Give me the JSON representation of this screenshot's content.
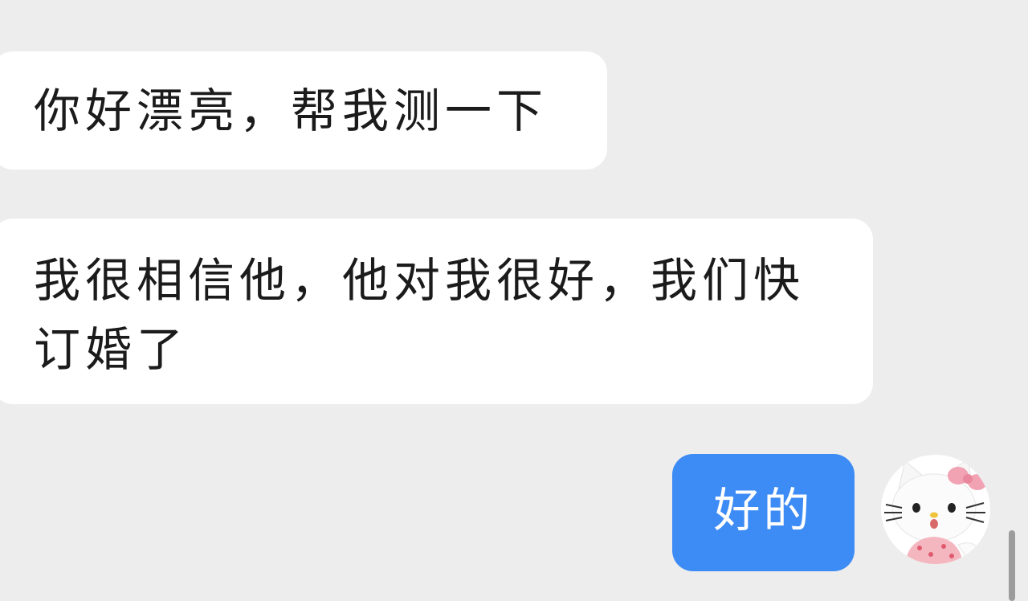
{
  "messages": [
    {
      "direction": "incoming",
      "text": "你好漂亮，帮我测一下"
    },
    {
      "direction": "incoming",
      "text": "我很相信他，他对我很好，我们快订婚了"
    },
    {
      "direction": "outgoing",
      "text": "好的"
    }
  ],
  "avatar": {
    "icon": "hello-kitty-avatar-icon"
  },
  "colors": {
    "background": "#ededed",
    "incoming_bubble": "#ffffff",
    "outgoing_bubble": "#3d8bf4"
  }
}
